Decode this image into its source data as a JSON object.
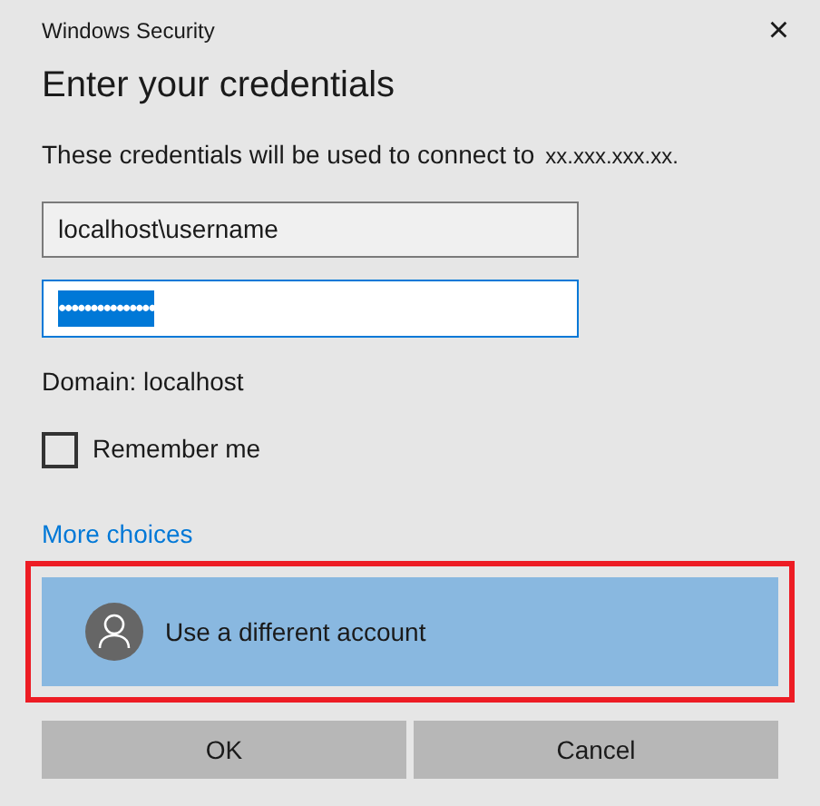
{
  "window": {
    "title": "Windows Security",
    "close": "×"
  },
  "heading": "Enter your credentials",
  "description": "These credentials will be used to connect to",
  "address": "xx.xxx.xxx.xx.",
  "username": {
    "value": "localhost\\username"
  },
  "password": {
    "value": "•••••••••••••••",
    "focused": true,
    "text_selected": true
  },
  "domain": "Domain: localhost",
  "remember": {
    "label": "Remember me",
    "checked": false
  },
  "more_choices": "More choices",
  "account_option": {
    "label": "Use a different account",
    "highlighted": true
  },
  "buttons": [
    {
      "label": "OK"
    },
    {
      "label": "Cancel"
    }
  ]
}
